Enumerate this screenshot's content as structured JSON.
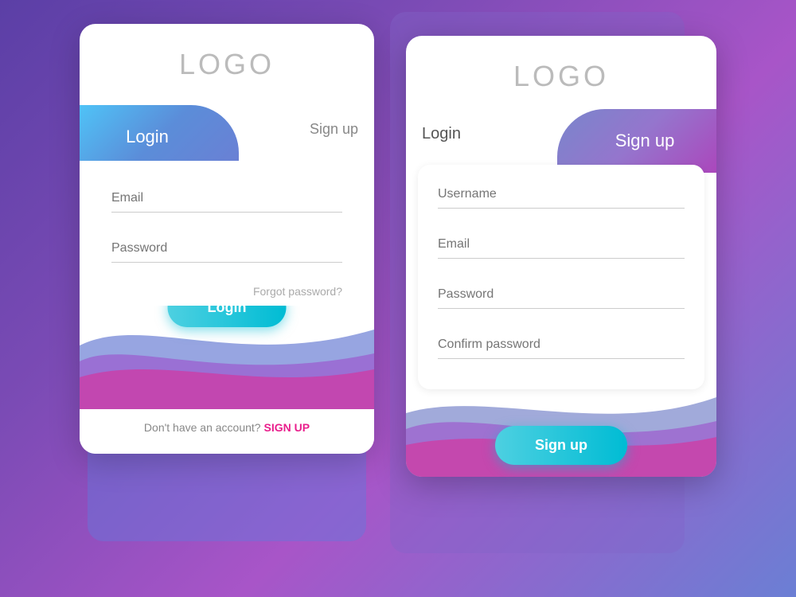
{
  "colors": {
    "accent_cyan": "#00bcd4",
    "accent_pink": "#e91e8c",
    "accent_purple": "#9c27b0",
    "tab_blue_gradient_start": "#4fc3f7",
    "tab_blue_gradient_end": "#6b7fd4",
    "tab_purple_gradient_start": "#7986cb",
    "tab_purple_gradient_end": "#ab47bc",
    "wave_blue": "#5b8dd9",
    "wave_pink": "#e91e8c",
    "wave_purple": "#9c4dcc"
  },
  "left_card": {
    "logo": "LOGO",
    "tab_login": "Login",
    "tab_signup": "Sign up",
    "email_placeholder": "Email",
    "password_placeholder": "Password",
    "forgot_password": "Forgot password?",
    "login_button": "Login",
    "bottom_text": "Don't have an account?",
    "signup_link": "SIGN UP"
  },
  "right_card": {
    "logo": "LOGO",
    "tab_login": "Login",
    "tab_signup": "Sign up",
    "username_placeholder": "Username",
    "email_placeholder": "Email",
    "password_placeholder": "Password",
    "confirm_password_placeholder": "Confirm password",
    "signup_button": "Sign up"
  }
}
